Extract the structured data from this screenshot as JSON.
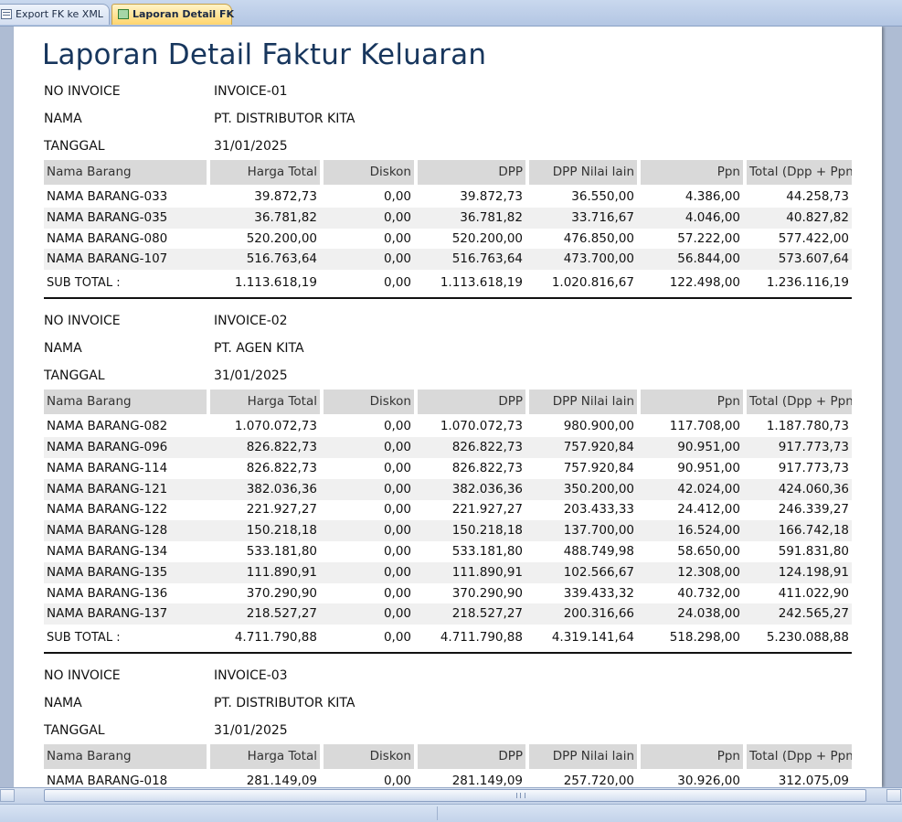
{
  "tabs": [
    {
      "label": "Export FK ke XML",
      "icon": "form-icon",
      "active": false
    },
    {
      "label": "Laporan Detail FK",
      "icon": "report-icon",
      "active": true
    }
  ],
  "report": {
    "title": "Laporan Detail Faktur Keluaran",
    "field_labels": {
      "invoice": "NO INVOICE",
      "name": "NAMA",
      "date": "TANGGAL"
    },
    "columns": [
      "Nama Barang",
      "Harga Total",
      "Diskon",
      "DPP",
      "DPP Nilai lain",
      "Ppn",
      "Total (Dpp + Ppn)"
    ],
    "subtotal_label": "SUB TOTAL :",
    "invoices": [
      {
        "no_invoice": "INVOICE-01",
        "nama": "PT. DISTRIBUTOR KITA",
        "tanggal": "31/01/2025",
        "rows": [
          [
            "NAMA BARANG-033",
            "39.872,73",
            "0,00",
            "39.872,73",
            "36.550,00",
            "4.386,00",
            "44.258,73"
          ],
          [
            "NAMA BARANG-035",
            "36.781,82",
            "0,00",
            "36.781,82",
            "33.716,67",
            "4.046,00",
            "40.827,82"
          ],
          [
            "NAMA BARANG-080",
            "520.200,00",
            "0,00",
            "520.200,00",
            "476.850,00",
            "57.222,00",
            "577.422,00"
          ],
          [
            "NAMA BARANG-107",
            "516.763,64",
            "0,00",
            "516.763,64",
            "473.700,00",
            "56.844,00",
            "573.607,64"
          ]
        ],
        "subtotal": [
          "1.113.618,19",
          "0,00",
          "1.113.618,19",
          "1.020.816,67",
          "122.498,00",
          "1.236.116,19"
        ]
      },
      {
        "no_invoice": "INVOICE-02",
        "nama": "PT. AGEN KITA",
        "tanggal": "31/01/2025",
        "rows": [
          [
            "NAMA BARANG-082",
            "1.070.072,73",
            "0,00",
            "1.070.072,73",
            "980.900,00",
            "117.708,00",
            "1.187.780,73"
          ],
          [
            "NAMA BARANG-096",
            "826.822,73",
            "0,00",
            "826.822,73",
            "757.920,84",
            "90.951,00",
            "917.773,73"
          ],
          [
            "NAMA BARANG-114",
            "826.822,73",
            "0,00",
            "826.822,73",
            "757.920,84",
            "90.951,00",
            "917.773,73"
          ],
          [
            "NAMA BARANG-121",
            "382.036,36",
            "0,00",
            "382.036,36",
            "350.200,00",
            "42.024,00",
            "424.060,36"
          ],
          [
            "NAMA BARANG-122",
            "221.927,27",
            "0,00",
            "221.927,27",
            "203.433,33",
            "24.412,00",
            "246.339,27"
          ],
          [
            "NAMA BARANG-128",
            "150.218,18",
            "0,00",
            "150.218,18",
            "137.700,00",
            "16.524,00",
            "166.742,18"
          ],
          [
            "NAMA BARANG-134",
            "533.181,80",
            "0,00",
            "533.181,80",
            "488.749,98",
            "58.650,00",
            "591.831,80"
          ],
          [
            "NAMA BARANG-135",
            "111.890,91",
            "0,00",
            "111.890,91",
            "102.566,67",
            "12.308,00",
            "124.198,91"
          ],
          [
            "NAMA BARANG-136",
            "370.290,90",
            "0,00",
            "370.290,90",
            "339.433,32",
            "40.732,00",
            "411.022,90"
          ],
          [
            "NAMA BARANG-137",
            "218.527,27",
            "0,00",
            "218.527,27",
            "200.316,66",
            "24.038,00",
            "242.565,27"
          ]
        ],
        "subtotal": [
          "4.711.790,88",
          "0,00",
          "4.711.790,88",
          "4.319.141,64",
          "518.298,00",
          "5.230.088,88"
        ]
      },
      {
        "no_invoice": "INVOICE-03",
        "nama": "PT. DISTRIBUTOR KITA",
        "tanggal": "31/01/2025",
        "rows": [
          [
            "NAMA BARANG-018",
            "281.149,09",
            "0,00",
            "281.149,09",
            "257.720,00",
            "30.926,00",
            "312.075,09"
          ]
        ],
        "subtotal": null
      }
    ]
  }
}
